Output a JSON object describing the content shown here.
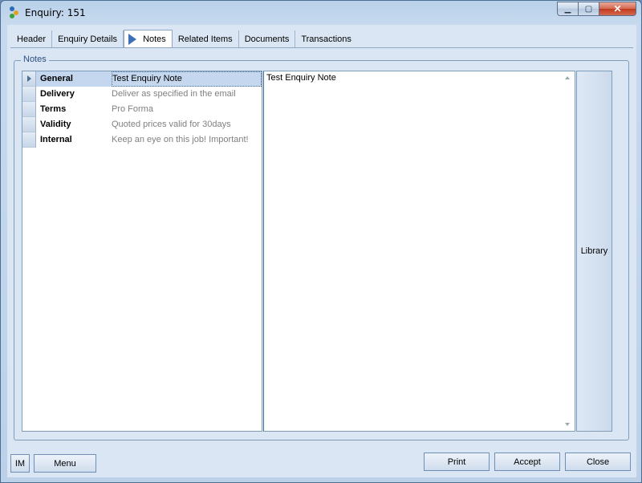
{
  "window": {
    "title": "Enquiry: 151"
  },
  "caption": {
    "minimize": "▁",
    "maximize": "▢",
    "close": "✕"
  },
  "tabs": [
    {
      "label": "Header"
    },
    {
      "label": "Enquiry Details"
    },
    {
      "label": "Notes",
      "active": true
    },
    {
      "label": "Related Items"
    },
    {
      "label": "Documents"
    },
    {
      "label": "Transactions"
    }
  ],
  "notes": {
    "group_label": "Notes",
    "rows": [
      {
        "name": "General",
        "value": "Test Enquiry Note",
        "selected": true
      },
      {
        "name": "Delivery",
        "value": "Deliver as specified in the email"
      },
      {
        "name": "Terms",
        "value": "Pro Forma"
      },
      {
        "name": "Validity",
        "value": "Quoted prices valid for 30days"
      },
      {
        "name": "Internal",
        "value": "Keep an eye on this job! Important!"
      }
    ],
    "editor_text": "Test Enquiry Note",
    "library_label": "Library"
  },
  "buttons": {
    "im": "IM",
    "menu": "Menu",
    "print": "Print",
    "accept": "Accept",
    "close": "Close"
  },
  "colors": {
    "accent": "#3d6fb6",
    "selection": "#c5d7ee",
    "panel": "#dae6f3"
  }
}
